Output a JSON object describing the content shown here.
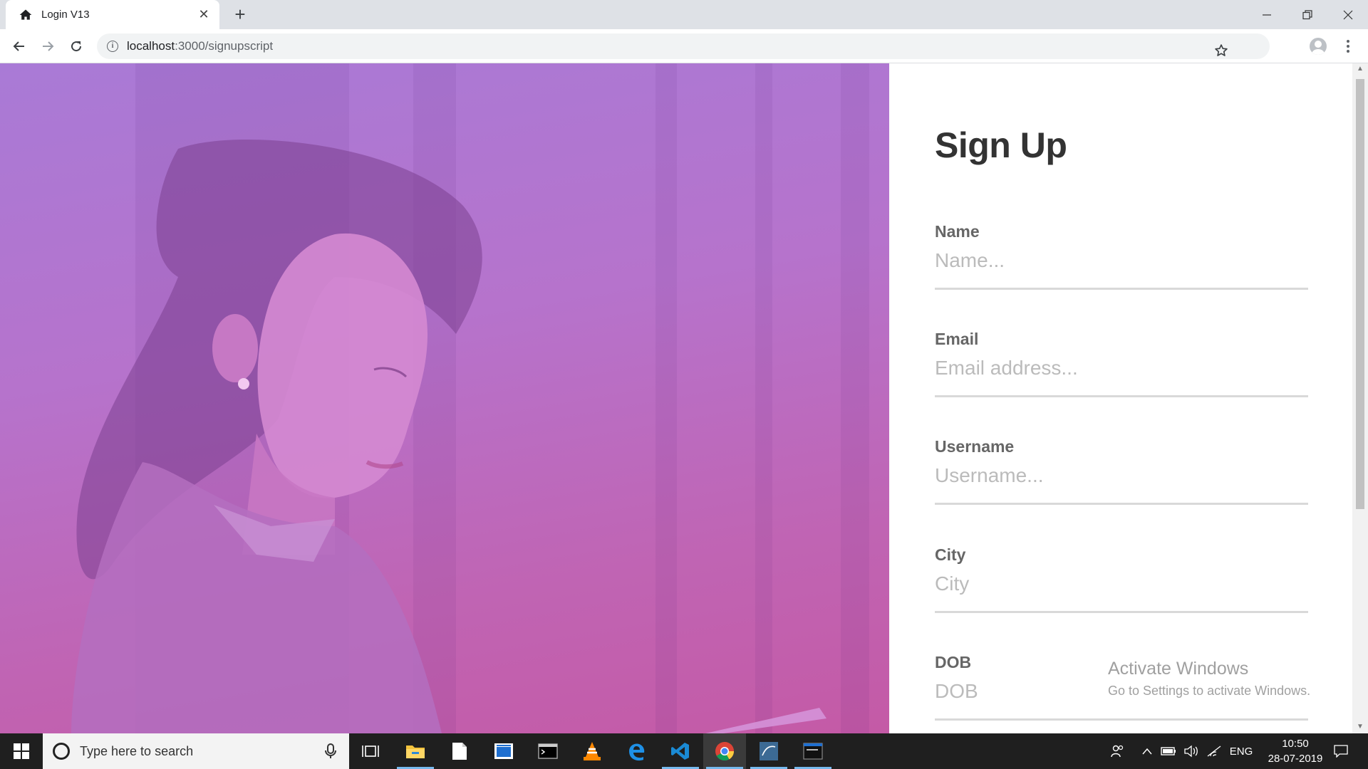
{
  "browser": {
    "tab_title": "Login V13",
    "url_host": "localhost",
    "url_path": ":3000/signupscript"
  },
  "form": {
    "title": "Sign Up",
    "fields": [
      {
        "label": "Name",
        "placeholder": "Name...",
        "value": ""
      },
      {
        "label": "Email",
        "placeholder": "Email address...",
        "value": ""
      },
      {
        "label": "Username",
        "placeholder": "Username...",
        "value": ""
      },
      {
        "label": "City",
        "placeholder": "City",
        "value": ""
      },
      {
        "label": "DOB",
        "placeholder": "DOB",
        "value": ""
      }
    ]
  },
  "watermark": {
    "line1": "Activate Windows",
    "line2": "Go to Settings to activate Windows."
  },
  "taskbar": {
    "search_placeholder": "Type here to search",
    "pinned_apps": [
      "task-view",
      "file-explorer",
      "notepad",
      "store",
      "terminal",
      "vlc",
      "edge",
      "vscode",
      "chrome",
      "mysql-workbench",
      "mysql-shell"
    ],
    "tray": {
      "language": "ENG",
      "time": "10:50",
      "date": "28-07-2019"
    }
  },
  "colors": {
    "hero_top": "#a97ad6",
    "hero_bottom": "#c45aa6",
    "title": "#333333",
    "label": "#666666",
    "placeholder": "#bbbbbb",
    "taskbar": "#1f1f1f"
  }
}
